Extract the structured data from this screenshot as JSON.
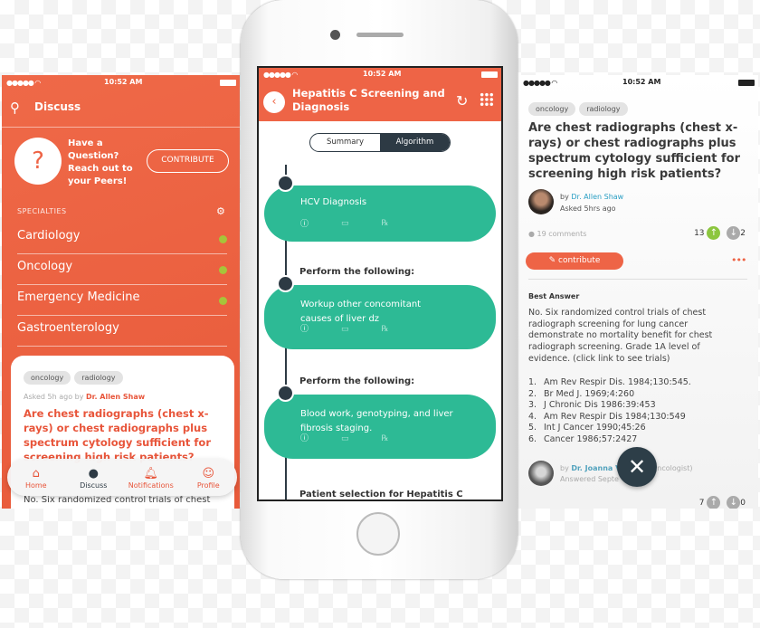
{
  "status_time": "10:52 AM",
  "left": {
    "header_title": "Discuss",
    "promo_text": [
      "Have a",
      "Question?",
      "Reach out to",
      "your Peers!"
    ],
    "contribute_label": "CONTRIBUTE",
    "specialties_label": "SPECIALTIES",
    "specialties": [
      {
        "label": "Cardiology",
        "dot": true
      },
      {
        "label": "Oncology",
        "dot": true
      },
      {
        "label": "Emergency Medicine",
        "dot": true
      },
      {
        "label": "Gastroenterology",
        "dot": false
      }
    ],
    "card": {
      "tags": [
        "oncology",
        "radiology"
      ],
      "asked": "Asked 5h ago by",
      "author": "Dr. Allen Shaw",
      "title": "Are chest radiographs (chest x-rays) or chest radiographs plus spectrum cytology sufficient for screening high risk patients?",
      "preview": "No.  Six randomized control trials of chest"
    },
    "tabs": [
      {
        "label": "Home",
        "icon": "home-icon"
      },
      {
        "label": "Discuss",
        "icon": "chat-bubble-icon"
      },
      {
        "label": "Notifications",
        "icon": "bell-icon"
      },
      {
        "label": "Profile",
        "icon": "user-icon"
      }
    ]
  },
  "center": {
    "title": "Hepatitis C Screening and Diagnosis",
    "segments": [
      "Summary",
      "Algorithm"
    ],
    "selected_segment": "Algorithm",
    "steps": [
      {
        "label": "",
        "text": "HCV Diagnosis"
      },
      {
        "label": "Perform the following:",
        "text": "Workup other concomitant causes of liver dz"
      },
      {
        "label": "Perform the following:",
        "text": "Blood work, genotyping, and liver fibrosis staging."
      }
    ],
    "next_label": "Patient selection for Hepatitis C"
  },
  "right": {
    "tags": [
      "oncology",
      "radiology"
    ],
    "title": "Are chest radiographs (chest x-rays) or chest radiographs plus spectrum cytology sufficient for screening high risk patients?",
    "by": "by",
    "author": "Dr. Allen Shaw",
    "asked": "Asked 5hrs ago",
    "comments": "19 comments",
    "upvotes": "13",
    "downvotes": "2",
    "contribute_label": "contribute",
    "best_answer_label": "Best Answer",
    "answer": "No.  Six randomized control trials of chest radiograph screening for lung cancer demonstrate no mortality benefit for chest radiograph screening.  Grade 1A level of evidence. (click link to see trials)",
    "references": [
      "Am Rev Respir Dis. 1984;130:545.",
      "Br Med J. 1969;4:260",
      "J Chronic Dis 1986:39:453",
      "Am Rev Respir Dis 1984;130:549",
      "Int J Cancer 1990;45:26",
      "Cancer 1986;57:2427"
    ],
    "answer_author": "Dr. Joanna V",
    "answer_author_suffix": "ncologist)",
    "answered": "Answered Septe",
    "answer_upvotes": "7",
    "answer_downvotes": "0"
  },
  "colors": {
    "orange": "#ee6446",
    "teal": "#2dba95",
    "dark": "#2d3a44",
    "green": "#8cc63f"
  }
}
